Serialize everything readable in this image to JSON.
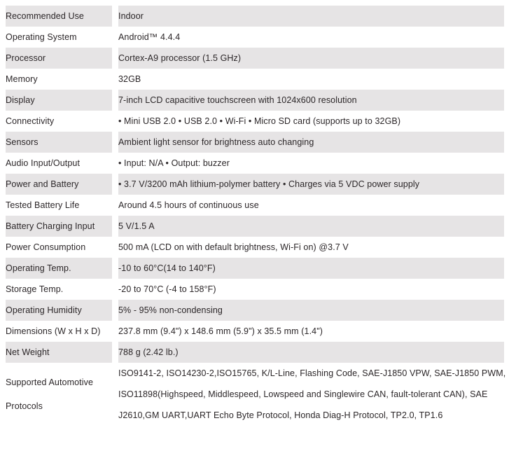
{
  "table": {
    "name": "product-specifications",
    "rows": [
      {
        "label": "Recommended Use",
        "value": "Indoor",
        "shaded": true
      },
      {
        "label": "Operating System",
        "value": "Android™ 4.4.4",
        "shaded": false
      },
      {
        "label": "Processor",
        "value": "Cortex-A9 processor (1.5 GHz)",
        "shaded": true
      },
      {
        "label": "Memory",
        "value": "32GB",
        "shaded": false
      },
      {
        "label": "Display",
        "value": "7-inch LCD capacitive touchscreen with 1024x600 resolution",
        "shaded": true
      },
      {
        "label": "Connectivity",
        "value": "• Mini USB 2.0 • USB 2.0 • Wi-Fi • Micro SD card (supports up to 32GB)",
        "shaded": false
      },
      {
        "label": "Sensors",
        "value": "Ambient light sensor for brightness auto changing",
        "shaded": true
      },
      {
        "label": "Audio Input/Output",
        "value": "• Input: N/A • Output: buzzer",
        "shaded": false
      },
      {
        "label": "Power and Battery",
        "value": "• 3.7 V/3200 mAh lithium-polymer battery • Charges via 5 VDC power supply",
        "shaded": true
      },
      {
        "label": "Tested Battery Life",
        "value": "Around 4.5 hours of continuous use",
        "shaded": false
      },
      {
        "label": "Battery Charging Input",
        "value": "5 V/1.5 A",
        "shaded": true
      },
      {
        "label": "Power Consumption",
        "value": "500 mA (LCD on with default brightness, Wi-Fi on) @3.7 V",
        "shaded": false
      },
      {
        "label": "Operating Temp.",
        "value": "-10 to 60°C(14 to 140°F)",
        "shaded": true
      },
      {
        "label": "Storage Temp.",
        "value": "-20 to 70°C (-4 to 158°F)",
        "shaded": false
      },
      {
        "label": "Operating Humidity",
        "value": "5% - 95% non-condensing",
        "shaded": true
      },
      {
        "label": "Dimensions (W x H x D)",
        "value": "237.8 mm (9.4\") x 148.6 mm (5.9\") x 35.5 mm (1.4\")",
        "shaded": false
      },
      {
        "label": "Net Weight",
        "value": "788 g (2.42 lb.)",
        "shaded": true
      }
    ],
    "protocols_row": {
      "shaded": false,
      "label_lines": [
        "Supported Automotive",
        "Protocols"
      ],
      "value_lines": [
        "ISO9141-2, ISO14230-2,ISO15765, K/L-Line, Flashing Code, SAE-J1850 VPW, SAE-J1850 PWM,",
        "ISO11898(Highspeed, Middlespeed, Lowspeed and Singlewire CAN, fault-tolerant CAN), SAE",
        "J2610,GM UART,UART Echo Byte Protocol, Honda Diag-H Protocol, TP2.0, TP1.6"
      ]
    }
  },
  "colors": {
    "shaded_row_background": "#e6e4e5",
    "plain_row_background": "#ffffff",
    "text": "#2b2628",
    "page_background": "#ffffff"
  }
}
